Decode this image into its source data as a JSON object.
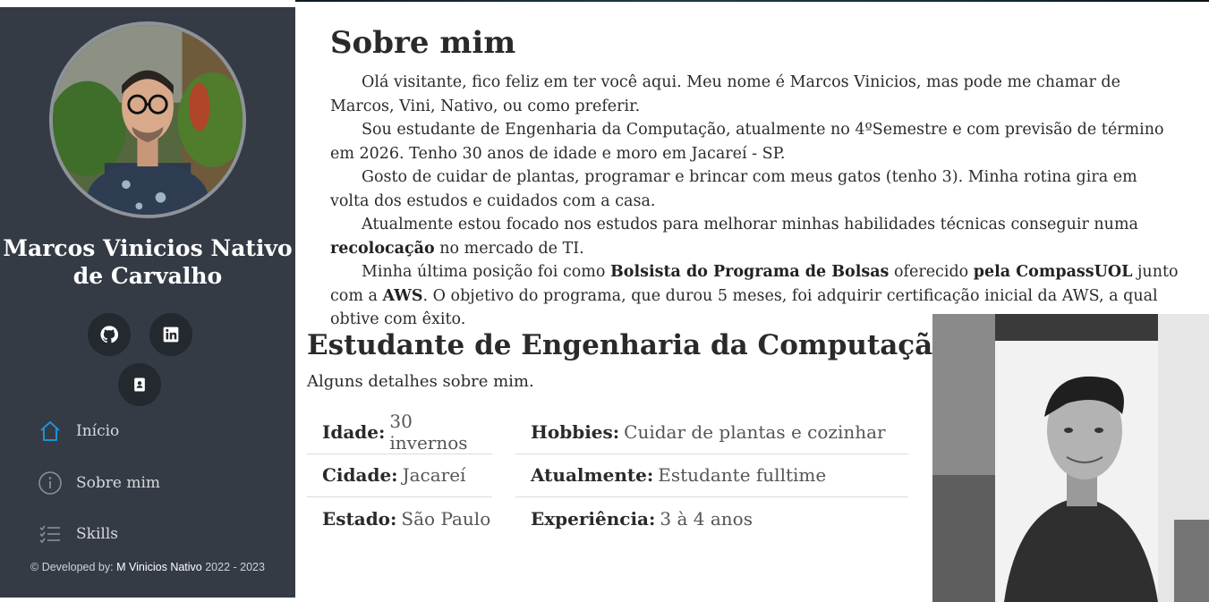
{
  "sidebar": {
    "name": "Marcos Vinicios Nativo de Carvalho",
    "social": [
      {
        "icon": "github-icon",
        "label": "GitHub"
      },
      {
        "icon": "linkedin-icon",
        "label": "LinkedIn"
      },
      {
        "icon": "contact-card-icon",
        "label": "Contato"
      }
    ],
    "nav": [
      {
        "label": "Início",
        "icon": "home-icon",
        "active": true
      },
      {
        "label": "Sobre mim",
        "icon": "info-icon",
        "active": false
      },
      {
        "label": "Skills",
        "icon": "list-checks-icon",
        "active": false
      }
    ],
    "footer": {
      "prefix": "© Developed by:",
      "author": "M Vinicios Nativo",
      "years": "2022 - 2023"
    },
    "accent": "#1e90d6"
  },
  "about": {
    "title": "Sobre mim",
    "paragraphs": [
      {
        "segments": [
          {
            "t": "Olá visitante, fico feliz em ter você aqui. Meu nome é Marcos Vinicios, mas pode me chamar de Marcos, Vini, Nativo, ou como preferir.",
            "b": false
          }
        ]
      },
      {
        "segments": [
          {
            "t": "Sou estudante de Engenharia da Computação, atualmente no 4ºSemestre e com previsão de término em 2026. Tenho 30 anos de idade e moro em Jacareí - SP.",
            "b": false
          }
        ]
      },
      {
        "segments": [
          {
            "t": "Gosto de cuidar de plantas, programar e brincar com meus gatos (tenho 3). Minha rotina gira em volta dos estudos e cuidados com a casa.",
            "b": false
          }
        ]
      },
      {
        "segments": [
          {
            "t": "Atualmente estou focado nos estudos para melhorar minhas habilidades técnicas conseguir numa ",
            "b": false
          },
          {
            "t": "recolocação",
            "b": true
          },
          {
            "t": " no mercado de TI.",
            "b": false
          }
        ]
      },
      {
        "segments": [
          {
            "t": "Minha última posição foi como ",
            "b": false
          },
          {
            "t": "Bolsista do Programa de Bolsas",
            "b": true
          },
          {
            "t": " oferecido ",
            "b": false
          },
          {
            "t": "pela CompassUOL",
            "b": true
          },
          {
            "t": " junto com a ",
            "b": false
          },
          {
            "t": "AWS",
            "b": true
          },
          {
            "t": ". O objetivo do programa, que durou 5 meses, foi adquirir certificação inicial da AWS, a qual obtive com êxito.",
            "b": false
          }
        ]
      }
    ]
  },
  "course": {
    "title": "Estudante de Engenharia da Computação",
    "subtitle": "Alguns detalhes sobre mim."
  },
  "details": {
    "left": [
      {
        "k": "Idade:",
        "v": "30 invernos"
      },
      {
        "k": "Cidade:",
        "v": "Jacareí"
      },
      {
        "k": "Estado:",
        "v": "São Paulo"
      }
    ],
    "right": [
      {
        "k": "Hobbies:",
        "v": "Cuidar de plantas e cozinhar"
      },
      {
        "k": "Atualmente:",
        "v": "Estudante fulltime"
      },
      {
        "k": "Experiência:",
        "v": "3 à 4 anos"
      }
    ]
  }
}
